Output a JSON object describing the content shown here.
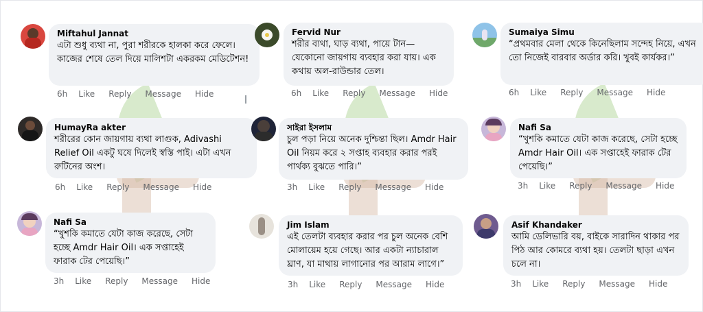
{
  "comments": [
    {
      "name": "Miftahul Jannat",
      "text": "এটা শুধু ব্যথা না, পুরা শরীরকে হালকা করে ফেলে। কাজের শেষে তেল দিয়ে মালিশটা একরকম মেডিটেশন!",
      "time": "6h",
      "like": "Like",
      "reply": "Reply",
      "message": "Message",
      "hide": "Hide",
      "avatar": "avatar-red-dress"
    },
    {
      "name": "Fervid Nur",
      "text": "শরীর ব্যথা, ঘাড় ব্যথা, পায়ে টান—যেকোনো জায়গায় ব্যবহার করা যায়। এক কথায় অল-রাউন্ডার তেল।",
      "time": "6h",
      "like": "Like",
      "reply": "Reply",
      "message": "Message",
      "hide": "Hide",
      "avatar": "avatar-white-flower"
    },
    {
      "name": "Sumaiya Simu",
      "text": "“প্রথমবার মেলা থেকে কিনেছিলাম সন্দেহ নিয়ে, এখন তো নিজেই বারবার অর্ডার করি। খুবই কার্যকর।”",
      "time": "6h",
      "like": "Like",
      "reply": "Reply",
      "message": "Message",
      "hide": "Hide",
      "avatar": "avatar-sky"
    },
    {
      "name": "HumayRa akter",
      "text": "শরীরের কোন জায়গায় ব্যথা লাগুক, Adivashi Relief Oil একটু ঘষে দিলেই স্বস্তি পাই। এটা এখন রুটিনের অংশ।",
      "time": "6h",
      "like": "Like",
      "reply": "Reply",
      "message": "Message",
      "hide": "Hide",
      "avatar": "avatar-dark"
    },
    {
      "name": "সাইরা ইসলাম",
      "text": "চুল পড়া নিয়ে অনেক দুশ্চিন্তা ছিল। Amdr Hair Oil নিয়ম করে ২ সপ্তাহ ব্যবহার করার পরই পার্থক্য বুঝতে পারি।”",
      "time": "3h",
      "like": "Like",
      "reply": "Reply",
      "message": "Message",
      "hide": "Hide",
      "avatar": "avatar-night"
    },
    {
      "name": "Nafi Sa",
      "text": "“খুশকি কমাতে যেটা কাজ করেছে, সেটা হচ্ছে Amdr Hair Oil। এক সপ্তাহেই ফারাক টের পেয়েছি।”",
      "time": "3h",
      "like": "Like",
      "reply": "Reply",
      "message": "Message",
      "hide": "Hide",
      "avatar": "avatar-girl"
    },
    {
      "name": "Nafi Sa",
      "text": "“খুশকি কমাতে যেটা কাজ করেছে, সেটা হচ্ছে Amdr Hair Oil। এক সপ্তাহেই ফারাক টের পেয়েছি।”",
      "time": "3h",
      "like": "Like",
      "reply": "Reply",
      "message": "Message",
      "hide": "Hide",
      "avatar": "avatar-girl"
    },
    {
      "name": "Jim Islam",
      "text": "এই তেলটা ব্যবহার করার পর চুল অনেক বেশি মোলায়েম হয়ে গেছে। আর একটা ন্যাচারাল ঘ্রাণ, যা মাথায় লাগানোর পর আরাম লাগে।”",
      "time": "3h",
      "like": "Like",
      "reply": "Reply",
      "message": "Message",
      "hide": "Hide",
      "avatar": "avatar-light"
    },
    {
      "name": "Asif Khandaker",
      "text": "আমি ডেলিভারি বয়, বাইকে সারাদিন থাকার পর পিঠ আর কোমরে ব্যথা হয়। তেলটা ছাড়া এখন চলে না।",
      "time": "3h",
      "like": "Like",
      "reply": "Reply",
      "message": "Message",
      "hide": "Hide",
      "avatar": "avatar-purple"
    }
  ],
  "colors": {
    "bubble": "#f0f2f5",
    "meta": "#65676b",
    "leaf": "#a8d08d",
    "stem": "#d4b9a5"
  }
}
